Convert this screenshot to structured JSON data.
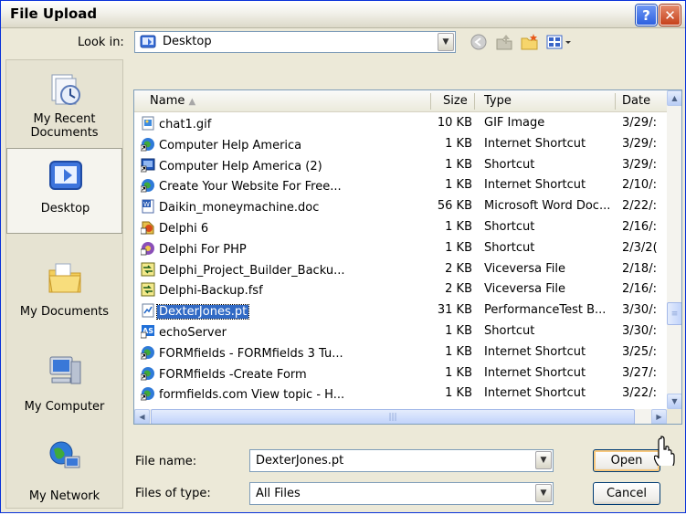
{
  "window": {
    "title": "File Upload"
  },
  "toolbar": {
    "look_in_label": "Look in:",
    "look_in_value": "Desktop"
  },
  "places": [
    {
      "label": "My Recent Documents",
      "icon": "recent-documents-icon"
    },
    {
      "label": "Desktop",
      "icon": "desktop-icon",
      "selected": true
    },
    {
      "label": "My Documents",
      "icon": "my-documents-icon"
    },
    {
      "label": "My Computer",
      "icon": "my-computer-icon"
    },
    {
      "label": "My Network",
      "icon": "my-network-icon"
    }
  ],
  "list": {
    "columns": {
      "name": "Name",
      "size": "Size",
      "type": "Type",
      "date": "Date"
    },
    "rows": [
      {
        "name": "chat1.gif",
        "size": "10 KB",
        "type": "GIF Image",
        "date": "3/29/:",
        "icon": "gif-image-icon"
      },
      {
        "name": "Computer Help America",
        "size": "1 KB",
        "type": "Internet Shortcut",
        "date": "3/29/:",
        "icon": "internet-shortcut-icon"
      },
      {
        "name": "Computer Help America (2)",
        "size": "1 KB",
        "type": "Shortcut",
        "date": "3/29/:",
        "icon": "shortcut-icon"
      },
      {
        "name": "Create Your Website For Free...",
        "size": "1 KB",
        "type": "Internet Shortcut",
        "date": "2/10/:",
        "icon": "internet-shortcut-icon"
      },
      {
        "name": "Daikin_moneymachine.doc",
        "size": "56 KB",
        "type": "Microsoft Word Doc...",
        "date": "2/22/:",
        "icon": "word-document-icon"
      },
      {
        "name": "Delphi 6",
        "size": "1 KB",
        "type": "Shortcut",
        "date": "2/16/:",
        "icon": "delphi-shortcut-icon"
      },
      {
        "name": "Delphi For PHP",
        "size": "1 KB",
        "type": "Shortcut",
        "date": "2/3/2(",
        "icon": "delphi-php-shortcut-icon"
      },
      {
        "name": "Delphi_Project_Builder_Backu...",
        "size": "2 KB",
        "type": "Viceversa File",
        "date": "2/18/:",
        "icon": "viceversa-file-icon"
      },
      {
        "name": "Delphi-Backup.fsf",
        "size": "2 KB",
        "type": "Viceversa File",
        "date": "2/16/:",
        "icon": "viceversa-file-icon"
      },
      {
        "name": "DexterJones.pt",
        "size": "31 KB",
        "type": "PerformanceTest B...",
        "date": "3/30/:",
        "icon": "performancetest-file-icon",
        "selected": true
      },
      {
        "name": "echoServer",
        "size": "1 KB",
        "type": "Shortcut",
        "date": "3/30/:",
        "icon": "as-shortcut-icon"
      },
      {
        "name": "FORMfields - FORMfields 3 Tu...",
        "size": "1 KB",
        "type": "Internet Shortcut",
        "date": "3/25/:",
        "icon": "internet-shortcut-icon"
      },
      {
        "name": "FORMfields -Create Form",
        "size": "1 KB",
        "type": "Internet Shortcut",
        "date": "3/27/:",
        "icon": "internet-shortcut-icon"
      },
      {
        "name": "formfields.com  View topic - H...",
        "size": "1 KB",
        "type": "Internet Shortcut",
        "date": "3/22/:",
        "icon": "internet-shortcut-icon"
      }
    ]
  },
  "form": {
    "file_name_label": "File name:",
    "file_name_value": "DexterJones.pt",
    "file_type_label": "Files of type:",
    "file_type_value": "All Files",
    "open_label": "Open",
    "cancel_label": "Cancel"
  },
  "colors": {
    "titlebar": "#ece9d8",
    "selection": "#316ac5",
    "border": "#7f9db9"
  }
}
